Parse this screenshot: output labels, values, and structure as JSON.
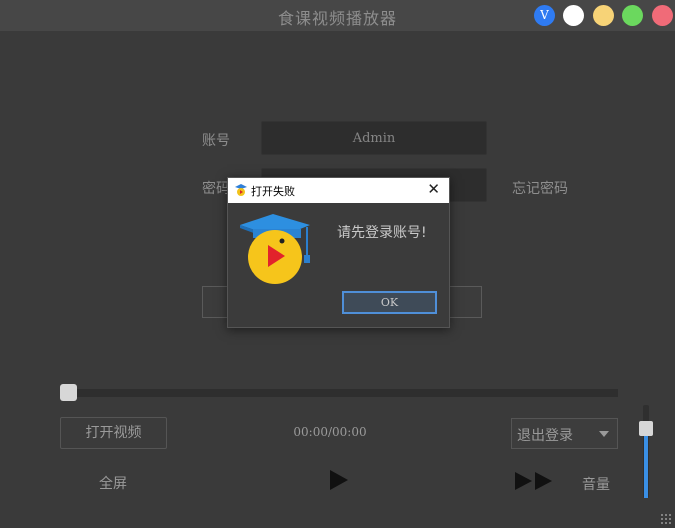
{
  "window": {
    "title": "食课视频播放器",
    "controls": [
      {
        "name": "v-badge",
        "label": "V",
        "color": "#2f7bf2"
      },
      {
        "name": "white",
        "color": "#ffffff"
      },
      {
        "name": "minimize",
        "color": "#f7d377"
      },
      {
        "name": "maximize",
        "color": "#6bd85e"
      },
      {
        "name": "close",
        "color": "#f06b78"
      }
    ]
  },
  "login": {
    "account_label": "账号",
    "account_value": "Admin",
    "password_label": "密码",
    "forgot_password": "忘记密码"
  },
  "player": {
    "progress_fraction": 0,
    "open_video_button": "打开视频",
    "time": "00:00/00:00",
    "account_menu": {
      "selected": "退出登录"
    },
    "fullscreen": "全屏",
    "volume_label": "音量",
    "volume_fraction": 0.75
  },
  "dialog": {
    "title": "打开失败",
    "message": "请先登录账号!",
    "ok_button": "OK",
    "icon": "graduation-mascot-icon"
  },
  "colors": {
    "accent_blue": "#3a8fe5",
    "background": "#3a3a3a"
  }
}
